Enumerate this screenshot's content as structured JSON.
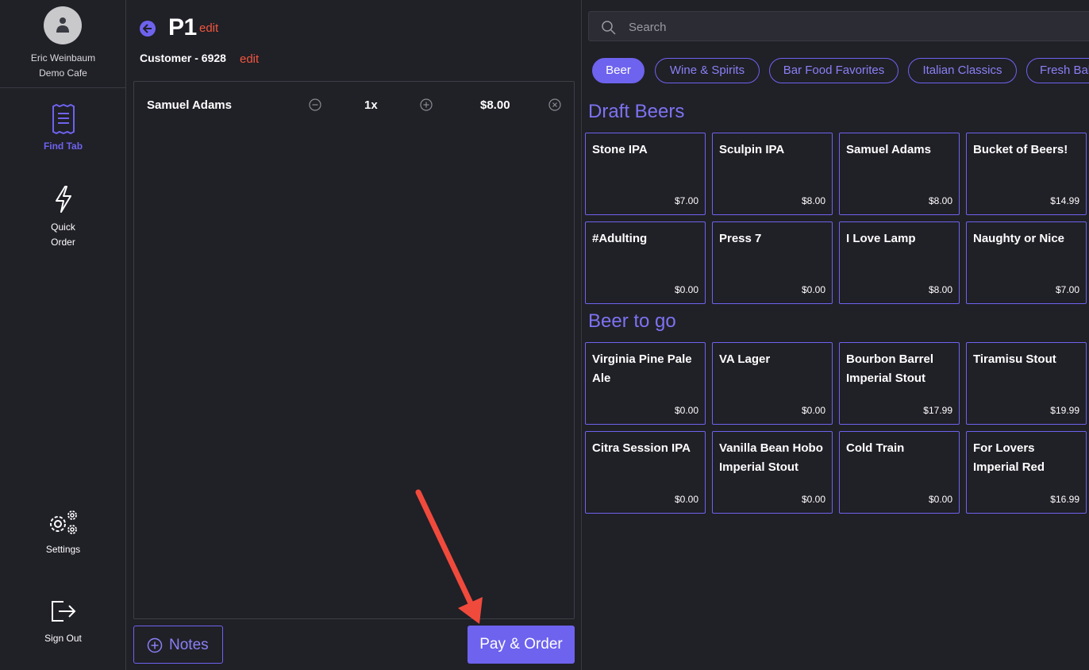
{
  "user": {
    "name": "Eric Weinbaum",
    "location": "Demo Cafe"
  },
  "nav": {
    "find_tab": "Find Tab",
    "quick_order_line1": "Quick",
    "quick_order_line2": "Order",
    "settings": "Settings",
    "sign_out": "Sign Out"
  },
  "tab": {
    "title": "P1",
    "edit": "edit",
    "customer": "Customer - 6928",
    "customer_edit": "edit"
  },
  "order_lines": [
    {
      "name": "Samuel Adams",
      "qty": "1x",
      "price": "$8.00"
    }
  ],
  "actions": {
    "notes": "Notes",
    "pay": "Pay & Order"
  },
  "search": {
    "placeholder": "Search"
  },
  "categories": [
    {
      "label": "Beer",
      "active": true
    },
    {
      "label": "Wine & Spirits",
      "active": false
    },
    {
      "label": "Bar Food Favorites",
      "active": false
    },
    {
      "label": "Italian Classics",
      "active": false
    },
    {
      "label": "Fresh Baked",
      "active": false
    }
  ],
  "sections": [
    {
      "title": "Draft Beers",
      "items": [
        {
          "name": "Stone IPA",
          "price": "$7.00"
        },
        {
          "name": "Sculpin IPA",
          "price": "$8.00"
        },
        {
          "name": "Samuel Adams",
          "price": "$8.00"
        },
        {
          "name": "Bucket of Beers!",
          "price": "$14.99"
        },
        {
          "name": "#Adulting",
          "price": "$0.00"
        },
        {
          "name": "Press 7",
          "price": "$0.00"
        },
        {
          "name": "I Love Lamp",
          "price": "$8.00"
        },
        {
          "name": "Naughty or Nice",
          "price": "$7.00"
        }
      ]
    },
    {
      "title": "Beer to go",
      "items": [
        {
          "name": "Virginia Pine Pale Ale",
          "price": "$0.00"
        },
        {
          "name": "VA Lager",
          "price": "$0.00"
        },
        {
          "name": "Bourbon Barrel Imperial Stout",
          "price": "$17.99"
        },
        {
          "name": "Tiramisu Stout",
          "price": "$19.99"
        },
        {
          "name": "Citra Session IPA",
          "price": "$0.00"
        },
        {
          "name": "Vanilla Bean Hobo Imperial Stout",
          "price": "$0.00"
        },
        {
          "name": "Cold Train",
          "price": "$0.00"
        },
        {
          "name": "For Lovers Imperial Red",
          "price": "$16.99"
        }
      ]
    }
  ],
  "colors": {
    "accent": "#6e63ee",
    "edit": "#f0563e",
    "annotation_arrow": "#f04a3c",
    "background": "#202027"
  }
}
